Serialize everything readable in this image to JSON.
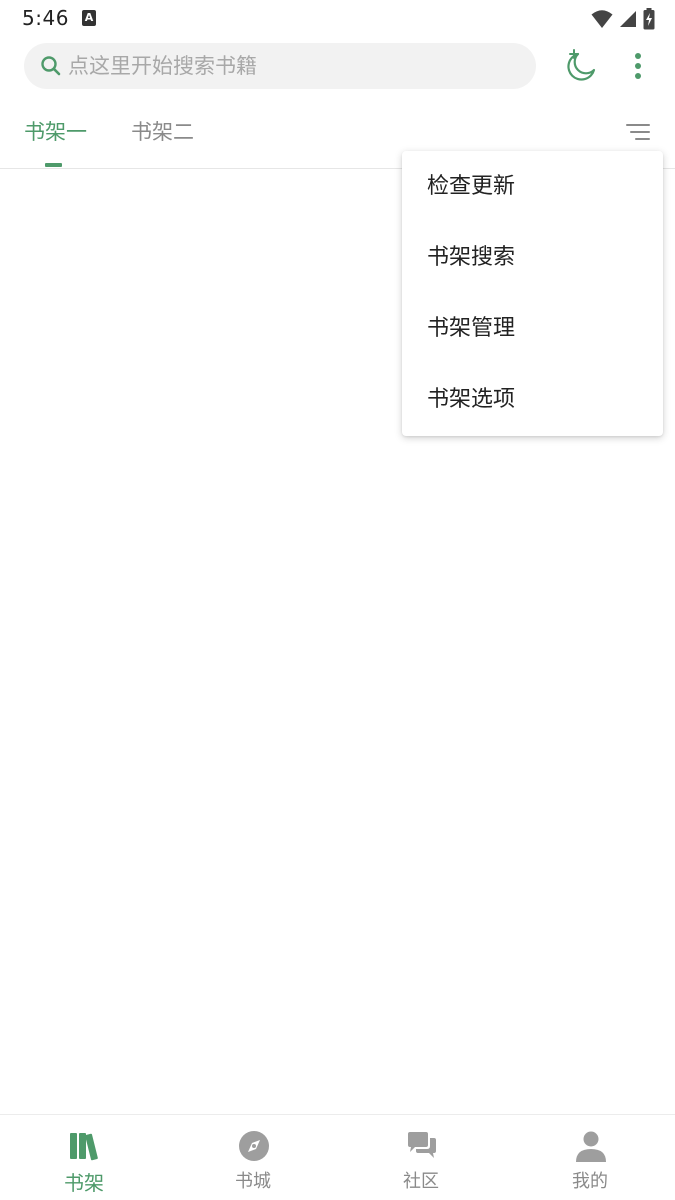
{
  "status_bar": {
    "time": "5:46",
    "notification_icon": "a-icon",
    "icons": [
      "wifi-icon",
      "signal-icon",
      "battery-charging-icon"
    ]
  },
  "search": {
    "placeholder": "点这里开始搜索书籍",
    "value": ""
  },
  "toolbar": {
    "night_mode_icon": "moon-icon",
    "more_icon": "more-vert-icon"
  },
  "tabs": [
    {
      "label": "书架一",
      "active": true
    },
    {
      "label": "书架二",
      "active": false
    }
  ],
  "sort_icon": "sort-lines-icon",
  "popup_menu": {
    "items": [
      {
        "label": "检查更新"
      },
      {
        "label": "书架搜索"
      },
      {
        "label": "书架管理"
      },
      {
        "label": "书架选项"
      }
    ]
  },
  "bottom_nav": {
    "items": [
      {
        "label": "书架",
        "icon": "bookshelf-icon",
        "active": true
      },
      {
        "label": "书城",
        "icon": "compass-icon",
        "active": false
      },
      {
        "label": "社区",
        "icon": "chat-bubbles-icon",
        "active": false
      },
      {
        "label": "我的",
        "icon": "person-icon",
        "active": false
      }
    ]
  },
  "colors": {
    "accent": "#4e9a6a",
    "inactive": "#8a8a8a",
    "search_bg": "#f2f2f2"
  }
}
